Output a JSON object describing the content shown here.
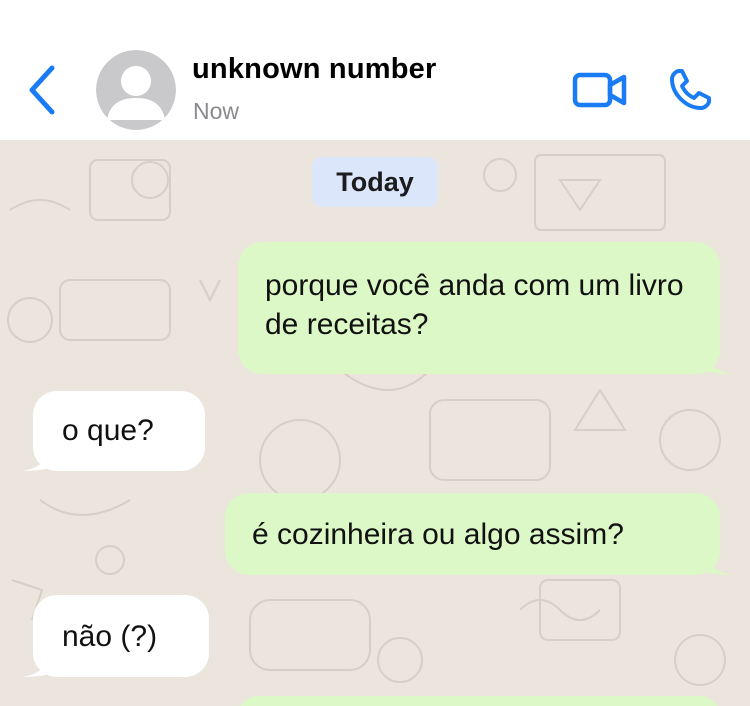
{
  "header": {
    "contact_name": "unknown number",
    "status": "Now",
    "accent_color": "#1a7cf5"
  },
  "chat": {
    "date_divider": "Today",
    "messages": [
      {
        "direction": "outgoing",
        "text": "porque você anda com um livro de receitas?"
      },
      {
        "direction": "incoming",
        "text": "o que?"
      },
      {
        "direction": "outgoing",
        "text": "é cozinheira ou algo assim?"
      },
      {
        "direction": "incoming",
        "text": "não (?)"
      },
      {
        "direction": "outgoing",
        "text": ""
      }
    ],
    "colors": {
      "outgoing_bubble": "#dcf8c6",
      "incoming_bubble": "#ffffff",
      "wallpaper": "#ece5dd",
      "date_pill": "#dbe6fb"
    }
  }
}
